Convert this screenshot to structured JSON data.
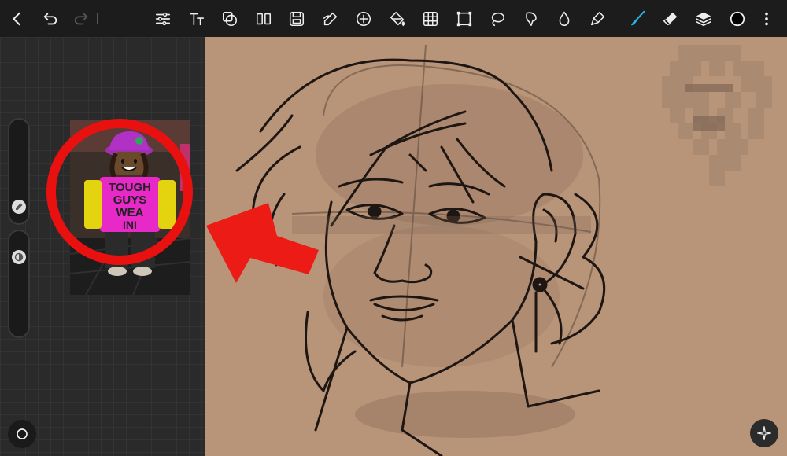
{
  "toolbar": {
    "left_tools": [
      "back-icon",
      "undo-icon",
      "redo-icon"
    ],
    "center_tools": [
      "adjust-icon",
      "text-icon",
      "shapes-icon",
      "symmetry-icon",
      "save-icon",
      "trace-icon",
      "add-icon",
      "fill-icon",
      "grid-icon",
      "transform-icon",
      "lasso-icon",
      "liquify-icon",
      "blur-icon",
      "smudge-icon"
    ],
    "right_tools": [
      "brush-icon",
      "eraser-icon",
      "layers-icon",
      "color-icon",
      "more-icon"
    ],
    "active_tool": "brush-icon",
    "accent_color": "#27b3e6"
  },
  "reference_image": {
    "shirt_text": [
      "TOUGH",
      "GUYS",
      "WEA",
      "INI"
    ]
  },
  "colors": {
    "canvas_bg": "#b89478",
    "ui_bg": "#1c1c1c",
    "annotation_red": "#e8110f"
  }
}
